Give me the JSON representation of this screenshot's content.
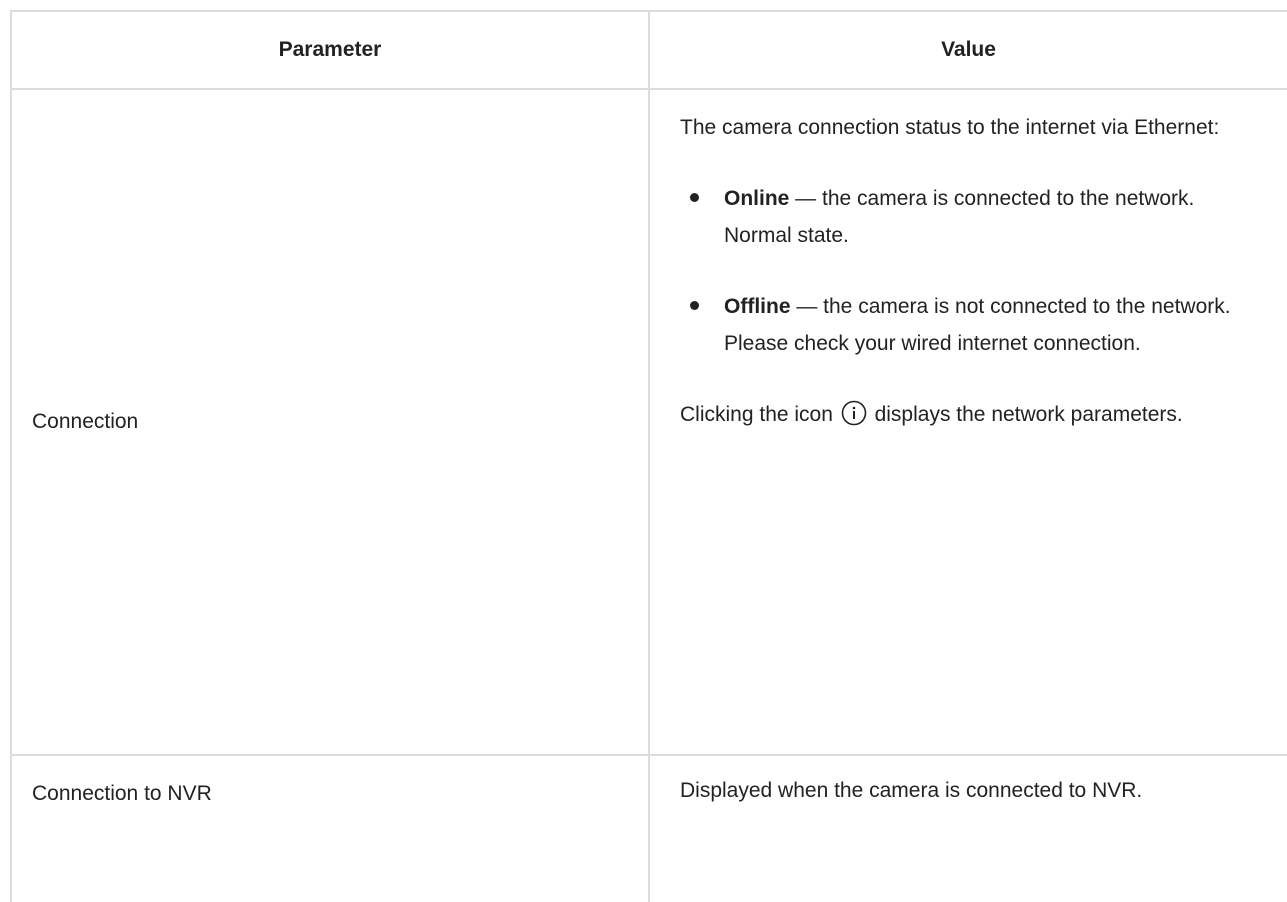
{
  "table": {
    "headers": {
      "parameter": "Parameter",
      "value": "Value"
    },
    "rows": [
      {
        "parameter": "Connection",
        "intro": "The camera connection status to the internet via Ethernet:",
        "items": [
          {
            "term": "Online",
            "separator": " — ",
            "text": "the camera is connected to the network. Normal state."
          },
          {
            "term": "Offline",
            "separator": " — ",
            "text": "the camera is not connected to the network. Please check your wired internet connection."
          }
        ],
        "note_before_icon": "Clicking the icon ",
        "icon": "info-icon",
        "note_after_icon": " displays the network parameters."
      },
      {
        "parameter": "Connection to NVR",
        "value": "Displayed when the camera is connected to NVR."
      }
    ]
  }
}
